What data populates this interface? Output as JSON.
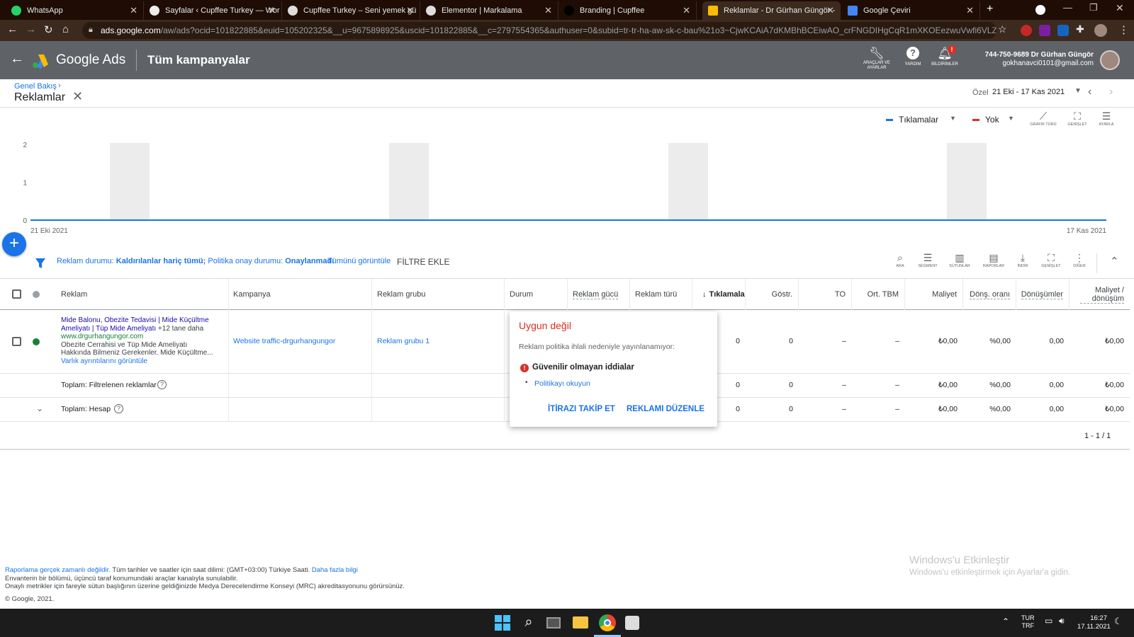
{
  "browser": {
    "tabs": [
      {
        "title": "WhatsApp",
        "icon": "whatsapp-icon",
        "color": "#25d366"
      },
      {
        "title": "Sayfalar ‹ Cupffee Turkey — Wor",
        "icon": "wordpress-icon",
        "color": "#ffffff"
      },
      {
        "title": "Cupffee Turkey – Seni yemek gü",
        "icon": "globe-icon",
        "color": "#ffffff"
      },
      {
        "title": "Elementor | Markalama",
        "icon": "globe-icon",
        "color": "#ffffff"
      },
      {
        "title": "Branding | Cupffee",
        "icon": "cupffee-icon",
        "color": "#000000"
      },
      {
        "title": "Reklamlar - Dr Gürhan Güngör -",
        "icon": "google-ads-icon",
        "color": "#fbbc04"
      },
      {
        "title": "Google Çeviri",
        "icon": "translate-icon",
        "color": "#4285f4"
      }
    ],
    "url_host": "ads.google.com",
    "url_path": "/aw/ads?ocid=101822885&euid=105202325&__u=9675898925&uscid=101822885&__c=2797554365&authuser=0&subid=tr-tr-ha-aw-sk-c-bau%21o3~CjwKCAiA7dKMBhBCEiwAO_crFNGDIHgCqR1mXKOEezwuVwfi6VLZYa5zjv..."
  },
  "header": {
    "product": "Google Ads",
    "page_title": "Tüm kampanyalar",
    "tools_label": "ARAÇLAR VE AYARLAR",
    "help_label": "YARDIM",
    "notifications_label": "BİLDİRİMLER",
    "notification_badge": "!",
    "account_id": "744-750-9689 Dr Gürhan Güngör",
    "account_email": "gokhanavci0101@gmail.com"
  },
  "subheader": {
    "breadcrumb": "Genel Bakış",
    "title": "Reklamlar",
    "date_prefix": "Özel",
    "date_range": "21 Eki - 17 Kas 2021"
  },
  "chart_controls": {
    "metric1": "Tıklamalar",
    "metric1_color": "#1a73e8",
    "metric2": "Yok",
    "metric2_color": "#d93025",
    "chart_type_label": "GRAFİK TÜRÜ",
    "expand_label": "GENİŞLET",
    "adjust_label": "AYARLA"
  },
  "chart_data": {
    "type": "line",
    "x_start": "21 Eki 2021",
    "x_end": "17 Kas 2021",
    "y_ticks": [
      "2",
      "1",
      "0"
    ],
    "ylim": [
      0,
      2
    ],
    "series": [
      {
        "values": [
          0,
          0
        ]
      }
    ],
    "weekend_bands": 4
  },
  "filter": {
    "part1_label": "Reklam durumu:",
    "part1_value": "Kaldırılanlar hariç tümü;",
    "part2_label": "Politika onay durumu:",
    "part2_value": "Onaylanmadı",
    "view_all": "Tümünü görüntüle",
    "add_filter": "FİLTRE EKLE",
    "tools": [
      "ARA",
      "SEGMENT",
      "SÜTUNLAR",
      "RAPORLAR",
      "İNDİR",
      "GENİŞLET",
      "DİĞER"
    ]
  },
  "table": {
    "headers": {
      "ad": "Reklam",
      "campaign": "Kampanya",
      "adgroup": "Reklam grubu",
      "status": "Durum",
      "strength": "Reklam gücü",
      "type": "Reklam türü",
      "clicks": "Tıklamalar",
      "impr": "Göstr.",
      "ctr": "TO",
      "cpc": "Ort. TBM",
      "cost": "Maliyet",
      "conv_rate": "Dönş. oranı",
      "conversions": "Dönüşümler",
      "cost_conv": "Maliyet / dönüşüm"
    },
    "row": {
      "headline": "Mide Balonu, Obezite Tedavisi | Mide Küçültme Ameliyatı | Tüp Mide Ameliyatı",
      "more": "+12 tane daha",
      "display_url": "www.drgurhangungor.com",
      "description": "Obezite Cerrahisi ve Tüp Mide Ameliyatı Hakkında Bilmeniz Gerekenler. Mide Küçültme...",
      "details_link": "Varlık ayrıntılarını görüntüle",
      "campaign": "Website traffic-drgurhangungor",
      "adgroup": "Reklam grubu 1",
      "clicks": "0",
      "impr": "0",
      "ctr": "–",
      "cpc": "–",
      "cost": "₺0,00",
      "conv_rate": "%0,00",
      "conversions": "0,00",
      "cost_conv": "₺0,00"
    },
    "total_filtered": {
      "label": "Toplam: Filtrelenen reklamlar",
      "clicks": "0",
      "impr": "0",
      "ctr": "–",
      "cpc": "–",
      "cost": "₺0,00",
      "conv_rate": "%0,00",
      "conversions": "0,00",
      "cost_conv": "₺0,00"
    },
    "total_account": {
      "label": "Toplam: Hesap",
      "clicks": "0",
      "impr": "0",
      "ctr": "–",
      "cpc": "–",
      "cost": "₺0,00",
      "conv_rate": "%0,00",
      "conversions": "0,00",
      "cost_conv": "₺0,00"
    },
    "pagination": "1 - 1 / 1"
  },
  "popup": {
    "title": "Uygun değil",
    "description": "Reklam politika ihlali nedeniyle yayınlanamıyor:",
    "issue": "Güvenilir olmayan iddialar",
    "policy_link": "Politikayı okuyun",
    "appeal_button": "İTİRAZI TAKİP ET",
    "edit_button": "REKLAMI DÜZENLE"
  },
  "footer": {
    "line1_link": "Raporlama gerçek zamanlı değildir.",
    "line1_text": "Tüm tarihler ve saatler için saat dilimi: (GMT+03:00) Türkiye Saati.",
    "line1_more": "Daha fazla bilgi",
    "line2": "Envanterin bir bölümü, üçüncü taraf konumundaki araçlar kanalıyla sunulabilir.",
    "line3": "Onaylı metrikler için fareyle sütun başlığının üzerine geldiğinizde Medya Derecelendirme Konseyi (MRC) akreditasyonunu görürsünüz.",
    "copyright": "© Google, 2021."
  },
  "watermark": {
    "title": "Windows'u Etkinleştir",
    "subtitle": "Windows'u etkinleştirmek için Ayarlar'a gidin."
  },
  "taskbar": {
    "lang1": "TUR",
    "lang2": "TRF",
    "time": "16:27",
    "date": "17.11.2021"
  }
}
